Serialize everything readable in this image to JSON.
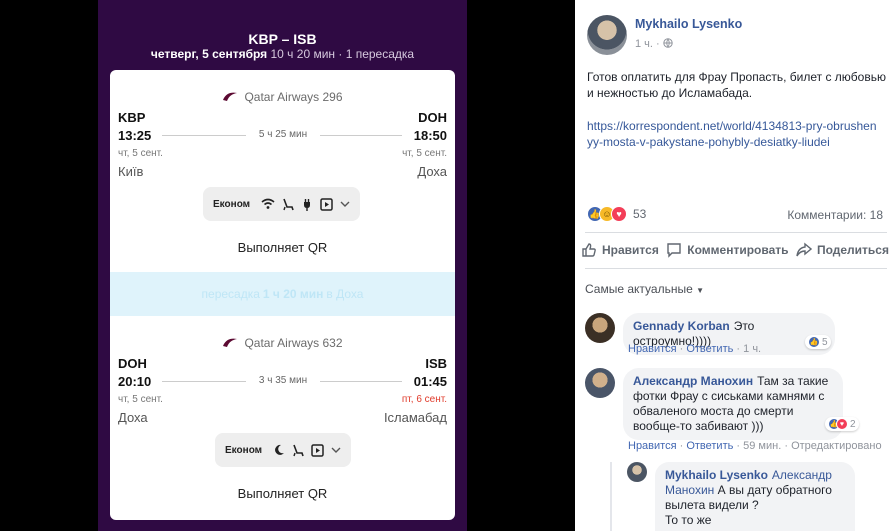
{
  "flight": {
    "route": "KBP – ISB",
    "date": "четверг, 5 сентября",
    "meta": "10 ч 20 мин · 1 пересадка",
    "segments": [
      {
        "airline": "Qatar Airways 296",
        "from_code": "KBP",
        "to_code": "DOH",
        "dep_time": "13:25",
        "arr_time": "18:50",
        "duration": "5 ч 25 мин",
        "dep_date": "чт, 5 сент.",
        "arr_date": "чт, 5 сент.",
        "from_city": "Київ",
        "to_city": "Доха",
        "cabin": "Економ",
        "operator": "Выполняет QR"
      },
      {
        "airline": "Qatar Airways 632",
        "from_code": "DOH",
        "to_code": "ISB",
        "dep_time": "20:10",
        "arr_time": "01:45",
        "duration": "3 ч 35 мин",
        "dep_date": "чт, 5 сент.",
        "arr_date": "пт, 6 сент.",
        "from_city": "Доха",
        "to_city": "Ісламабад",
        "cabin": "Економ",
        "operator": "Выполняет QR"
      }
    ],
    "layover": {
      "prefix": "пересадка",
      "duration": "1 ч 20 мин",
      "suffix": "в Доха"
    },
    "colors": {
      "header_bg": "#2f0a43",
      "layover_bg": "#dff3fb",
      "red_date": "#e03b2b"
    }
  },
  "post": {
    "author": "Mykhailo Lysenko",
    "time": "1 ч.",
    "text": "Готов оплатить для Фрау Пропасть, билет с любовью и нежностью до Исламабада.",
    "link": "https://korrespondent.net/world/4134813-pry-obrushenyy-mosta-v-pakystane-pohybly-desiatky-liudei",
    "reactions_count": "53",
    "comments_label": "Комментарии: 18",
    "actions": {
      "like": "Нравится",
      "comment": "Комментировать",
      "share": "Поделиться"
    },
    "sort_label": "Самые актуальные"
  },
  "comments": [
    {
      "name": "Gennady Korban",
      "text": "Это остроумно!))))",
      "like": "Нравится",
      "reply": "Ответить",
      "time": "1 ч.",
      "reacts": "5"
    },
    {
      "name": "Александр Манохин",
      "text": "Там за такие фотки Фрау с сиськами камнями с обваленого моста до смерти вообще-то забивают )))",
      "like": "Нравится",
      "reply": "Ответить",
      "time": "59 мин.",
      "edited": "Отредактировано",
      "reacts": "2"
    },
    {
      "name": "Mykhailo Lysenko",
      "mention": "Александр Манохин",
      "text": "А вы дату обратного вылета видели ?",
      "more": "То то же"
    }
  ]
}
